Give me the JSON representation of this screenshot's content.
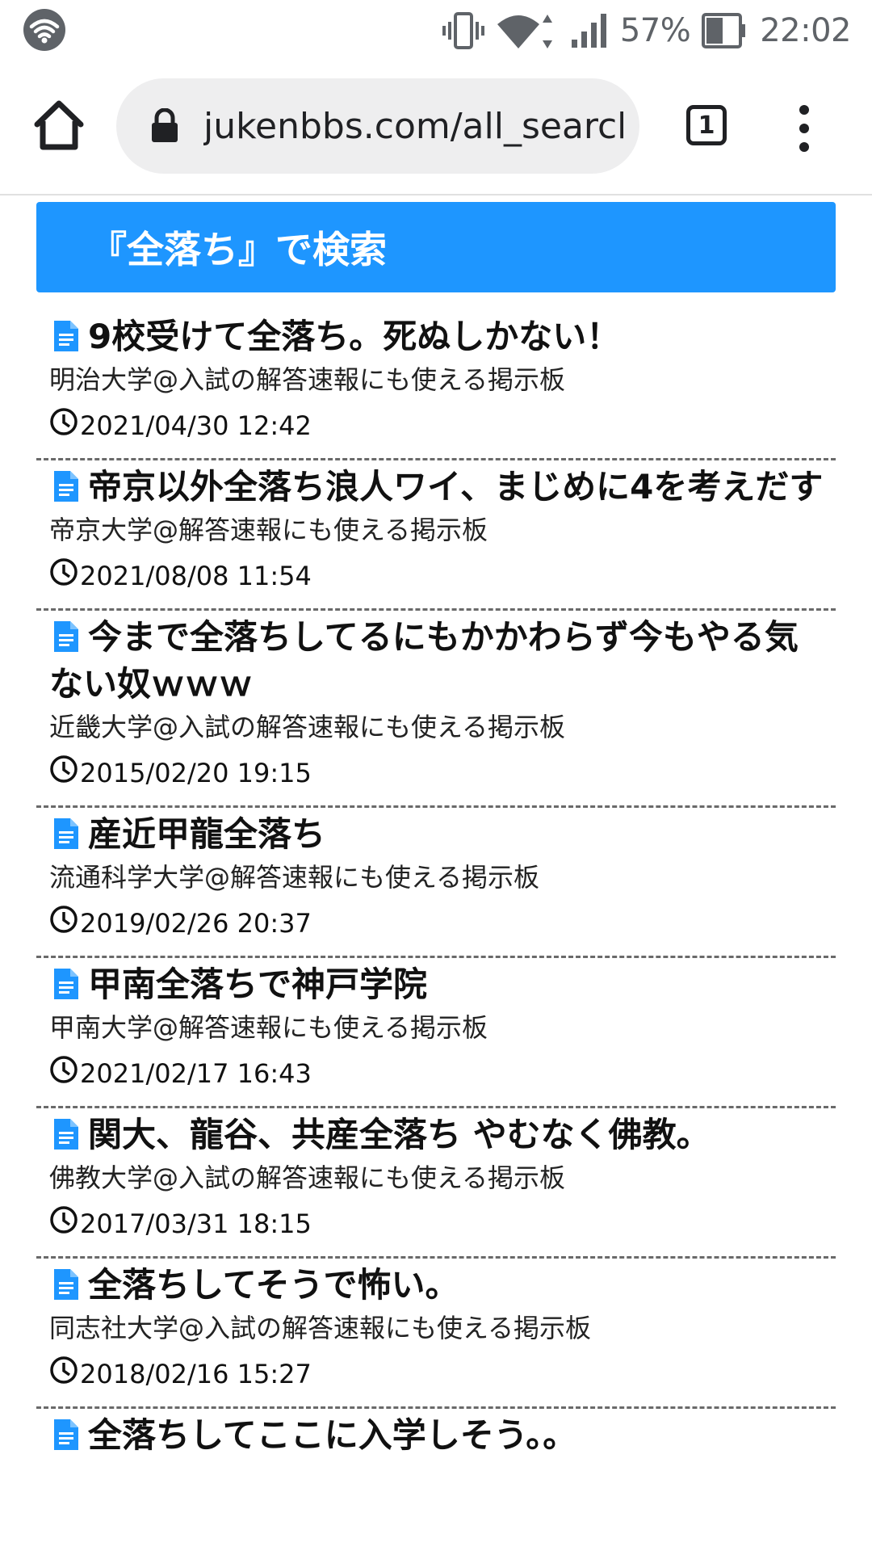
{
  "status_bar": {
    "battery_percent": "57%",
    "time": "22:02"
  },
  "browser": {
    "url": "jukenbbs.com/all_search",
    "tab_count": "1"
  },
  "search": {
    "header": "『全落ち』で検索"
  },
  "results": [
    {
      "title": "9校受けて全落ち。死ぬしかない！",
      "board": "明治大学@入試の解答速報にも使える掲示板",
      "date": "2021/04/30 12:42"
    },
    {
      "title": "帝京以外全落ち浪人ワイ、まじめに4を考えだす",
      "board": "帝京大学@解答速報にも使える掲示板",
      "date": "2021/08/08 11:54"
    },
    {
      "title": "今まで全落ちしてるにもかかわらず今もやる気ない奴ｗｗｗ",
      "board": "近畿大学@入試の解答速報にも使える掲示板",
      "date": "2015/02/20 19:15"
    },
    {
      "title": "産近甲龍全落ち",
      "board": "流通科学大学@解答速報にも使える掲示板",
      "date": "2019/02/26 20:37"
    },
    {
      "title": "甲南全落ちで神戸学院",
      "board": "甲南大学@解答速報にも使える掲示板",
      "date": "2021/02/17 16:43"
    },
    {
      "title": "関大、龍谷、共産全落ち やむなく佛教。",
      "board": "佛教大学@入試の解答速報にも使える掲示板",
      "date": "2017/03/31 18:15"
    },
    {
      "title": "全落ちしてそうで怖い。",
      "board": "同志社大学@入試の解答速報にも使える掲示板",
      "date": "2018/02/16 15:27"
    },
    {
      "title": "全落ちしてここに入学しそう。。",
      "board": "",
      "date": ""
    }
  ],
  "icons": {
    "wifi_status": "wifi-icon",
    "vibrate": "vibrate-icon",
    "signal": "signal-icon",
    "battery": "battery-icon",
    "home": "home-icon",
    "lock": "lock-icon",
    "menu": "more-vert-icon",
    "document": "document-icon",
    "clock": "clock-icon"
  },
  "colors": {
    "header_bg": "#1e96ff",
    "doc_icon": "#1e96ff",
    "url_pill": "#eeeeef"
  }
}
